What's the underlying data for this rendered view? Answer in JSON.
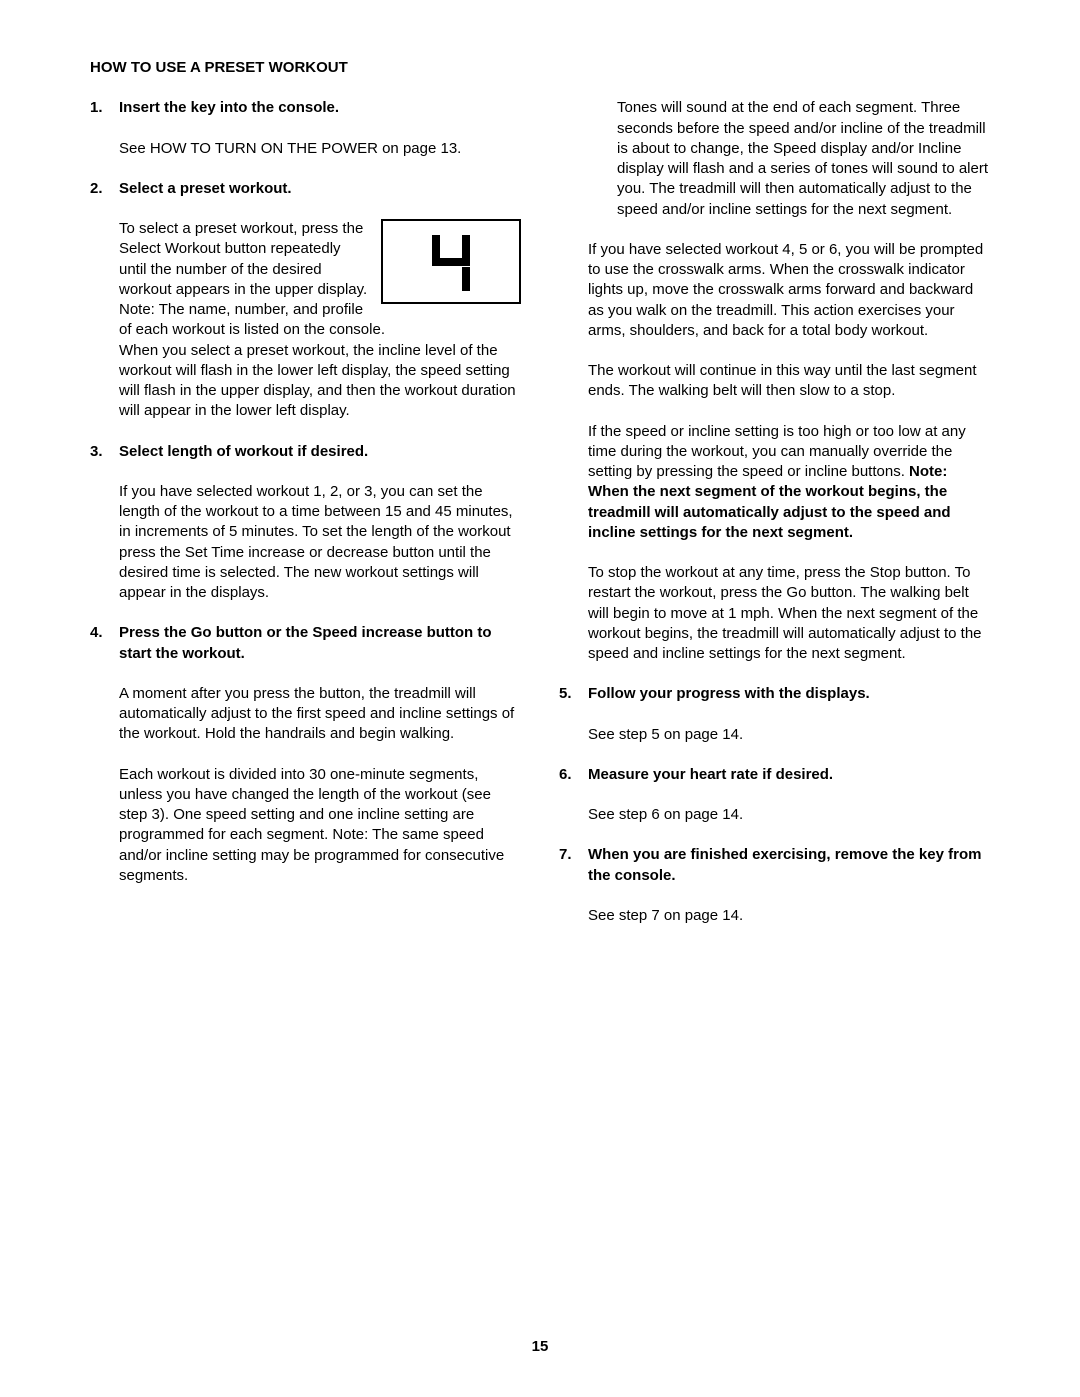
{
  "section_title": "HOW TO USE A PRESET WORKOUT",
  "steps": [
    {
      "num": "1.",
      "title": "Insert the key into the console.",
      "body1": "See HOW TO TURN ON THE POWER on page 13."
    },
    {
      "num": "2.",
      "title": "Select a preset workout.",
      "body1": "To select a preset workout, press the Select Workout button repeatedly until the number of the desired workout appears in the upper display. Note: The name, number, and profile of each workout is listed on the console.",
      "body2": "When you select a preset workout, the incline level of the workout will flash in the lower left display, the speed setting will flash in the upper display, and then the workout duration will appear in the lower left display.",
      "display_value": "4"
    },
    {
      "num": "3.",
      "title": "Select length of workout if desired.",
      "body1": "If you have selected workout 1, 2, or 3, you can set the length of the workout to a time between 15 and 45 minutes, in increments of 5 minutes. To set the length of the workout press the Set Time increase or decrease button until the desired time is selected. The new workout settings will appear in the displays."
    },
    {
      "num": "4.",
      "title": "Press the Go button or the Speed increase button to start the workout.",
      "body1": "A moment after you press the button, the treadmill will automatically adjust to the first speed and incline settings of the workout. Hold the handrails and begin walking.",
      "body2": "Each workout is divided into 30 one-minute segments, unless you have changed the length of the workout (see step 3). One speed setting and one incline setting are programmed for each segment. Note: The same speed and/or incline setting may be programmed for consecutive segments."
    }
  ],
  "right": {
    "cont1": "Tones will sound at the end of each segment. Three seconds before the speed and/or incline of the treadmill is about to change, the Speed display and/or Incline display will flash and a series of tones will sound to alert you. The treadmill will then automatically adjust to the speed and/or incline settings for the next segment.",
    "cont2": "If you have selected workout 4, 5 or 6, you will be prompted to use the crosswalk arms. When the crosswalk indicator lights up, move the crosswalk arms forward and backward as you walk on the treadmill. This action exercises your arms, shoulders, and back for a total body workout.",
    "cont3": "The workout will continue in this way until the last segment ends. The walking belt will then slow to a stop.",
    "cont4a": "If the speed or incline setting is too high or too low at any time during the workout, you can manually override the setting by pressing the speed or incline buttons. ",
    "cont4b": "Note: When the next segment of the workout begins, the treadmill will automatically adjust to the speed and incline settings for the next segment.",
    "cont5": "To stop the workout at any time, press the Stop button. To restart the workout, press the Go button. The walking belt will begin to move at 1 mph. When the next segment of the workout begins, the treadmill will automatically adjust to the speed and incline settings for the next segment.",
    "step5_num": "5.",
    "step5_title": "Follow your progress with the displays.",
    "step5_body": "See step 5 on page 14.",
    "step6_num": "6.",
    "step6_title": "Measure your heart rate if desired.",
    "step6_body": "See step 6 on page 14.",
    "step7_num": "7.",
    "step7_title": "When you are finished exercising, remove the key from the console.",
    "step7_body": "See step 7 on page 14."
  },
  "page_number": "15"
}
